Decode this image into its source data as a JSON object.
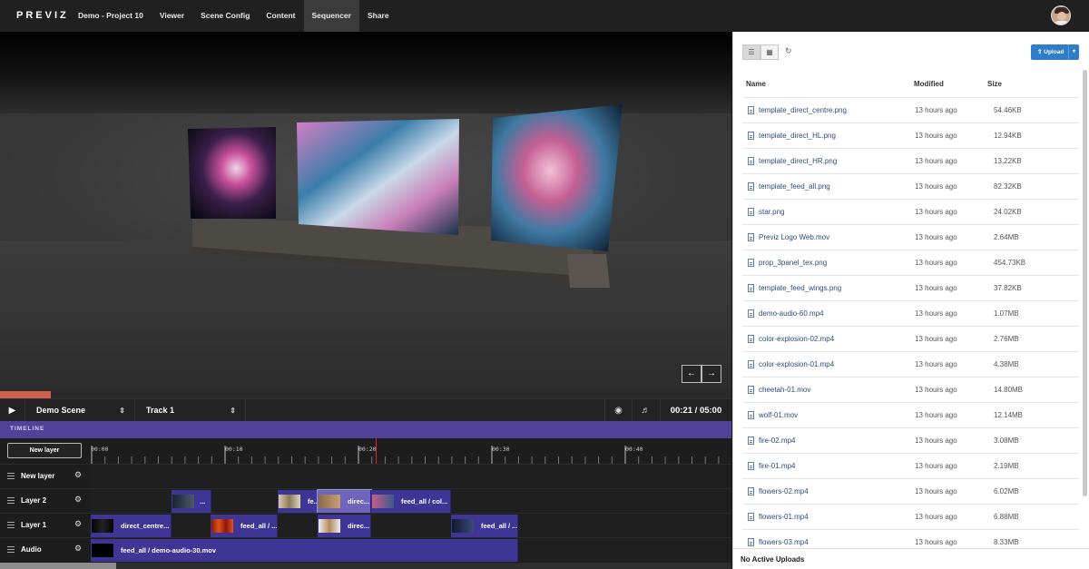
{
  "app": {
    "logo": "PREVIZ"
  },
  "nav": {
    "items": [
      "Demo - Project 10",
      "Viewer",
      "Scene Config",
      "Content",
      "Sequencer",
      "Share"
    ],
    "active_index": 4
  },
  "viewer": {
    "prev_icon": "arrow-left-icon",
    "next_icon": "arrow-right-icon"
  },
  "playback": {
    "progress_fraction": 0.07
  },
  "transport": {
    "scene": "Demo Scene",
    "track": "Track 1",
    "current_time": "00:21",
    "separator": "/",
    "duration": "05:00"
  },
  "timeline": {
    "header": "TIMELINE",
    "new_layer_button": "New layer",
    "ticks": [
      "00:00",
      "00:10",
      "00:20",
      "00:30",
      "00:40"
    ],
    "layers": [
      {
        "name": "New layer",
        "clips": []
      },
      {
        "name": "Layer 2",
        "clips": [
          {
            "label": "...",
            "style": "clip"
          },
          {
            "label": "fe...",
            "style": "clip"
          },
          {
            "label": "direc...",
            "style": "selected"
          },
          {
            "label": "feed_all / col...",
            "style": "clip"
          }
        ]
      },
      {
        "name": "Layer 1",
        "clips": [
          {
            "label": "direct_centre...",
            "style": "clip"
          },
          {
            "label": "feed_all / ...",
            "style": "clip"
          },
          {
            "label": "direc...",
            "style": "clip"
          },
          {
            "label": "feed_all / ...",
            "style": "clip"
          }
        ]
      },
      {
        "name": "Audio",
        "clips": [
          {
            "label": "feed_all / demo-audio-30.mov",
            "style": "clip"
          }
        ]
      }
    ]
  },
  "files": {
    "upload_button": "Upload",
    "columns": {
      "name": "Name",
      "modified": "Modified",
      "size": "Size"
    },
    "rows": [
      {
        "name": "template_direct_centre.png",
        "modified": "13 hours ago",
        "size": "54.46KB"
      },
      {
        "name": "template_direct_HL.png",
        "modified": "13 hours ago",
        "size": "12.94KB"
      },
      {
        "name": "template_direct_HR.png",
        "modified": "13 hours ago",
        "size": "13.22KB"
      },
      {
        "name": "template_feed_all.png",
        "modified": "13 hours ago",
        "size": "82.32KB"
      },
      {
        "name": "star.png",
        "modified": "13 hours ago",
        "size": "24.02KB"
      },
      {
        "name": "Previz Logo Web.mov",
        "modified": "13 hours ago",
        "size": "2.64MB"
      },
      {
        "name": "prop_3panel_tex.png",
        "modified": "13 hours ago",
        "size": "454.73KB"
      },
      {
        "name": "template_feed_wings.png",
        "modified": "13 hours ago",
        "size": "37.82KB"
      },
      {
        "name": "demo-audio-60.mp4",
        "modified": "13 hours ago",
        "size": "1.07MB"
      },
      {
        "name": "color-explosion-02.mp4",
        "modified": "13 hours ago",
        "size": "2.76MB"
      },
      {
        "name": "color-explosion-01.mp4",
        "modified": "13 hours ago",
        "size": "4.38MB"
      },
      {
        "name": "cheetah-01.mov",
        "modified": "13 hours ago",
        "size": "14.80MB"
      },
      {
        "name": "wolf-01.mov",
        "modified": "13 hours ago",
        "size": "12.14MB"
      },
      {
        "name": "fire-02.mp4",
        "modified": "13 hours ago",
        "size": "3.08MB"
      },
      {
        "name": "fire-01.mp4",
        "modified": "13 hours ago",
        "size": "2.19MB"
      },
      {
        "name": "flowers-02.mp4",
        "modified": "13 hours ago",
        "size": "6.02MB"
      },
      {
        "name": "flowers-01.mp4",
        "modified": "13 hours ago",
        "size": "6.88MB"
      },
      {
        "name": "flowers-03.mp4",
        "modified": "13 hours ago",
        "size": "8.33MB"
      }
    ],
    "footer": "No Active Uploads"
  },
  "colors": {
    "accent": "#524199",
    "clip": "#3f3596",
    "progress": "#d1604f",
    "upload": "#2e7dc8",
    "playhead": "#d12b2b"
  }
}
